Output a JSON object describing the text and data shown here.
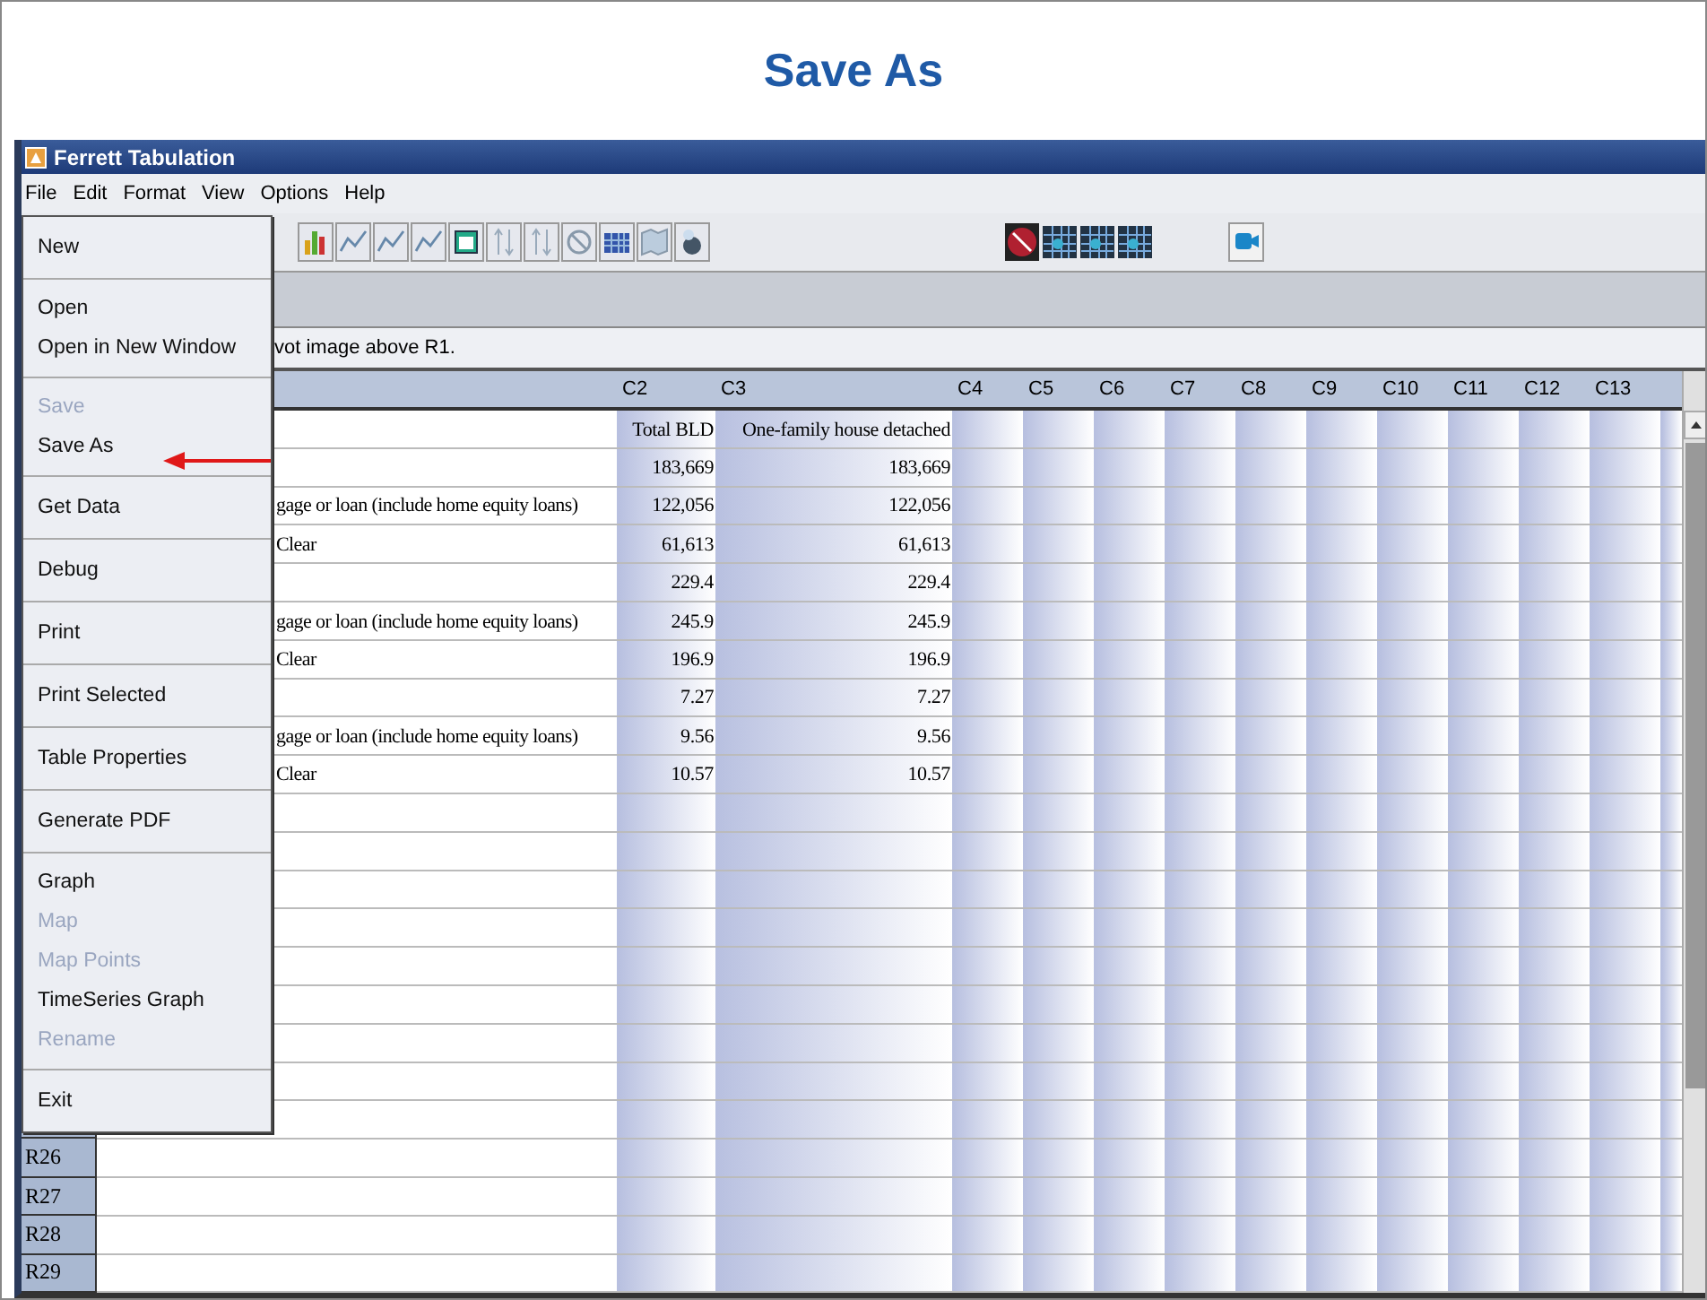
{
  "slide_title": "Save As",
  "window": {
    "title": "Ferrett Tabulation"
  },
  "menu_bar": [
    "File",
    "Edit",
    "Format",
    "View",
    "Options",
    "Help"
  ],
  "info_line": "vot image above R1.",
  "table": {
    "columns": [
      "C2",
      "C3",
      "C4",
      "C5",
      "C6",
      "C7",
      "C8",
      "C9",
      "C10",
      "C11",
      "C12",
      "C13"
    ],
    "rows": [
      {
        "label": "",
        "c2": "Total BLD",
        "c3": "One-family house detached"
      },
      {
        "label": "",
        "c2": "183,669",
        "c3": "183,669"
      },
      {
        "label": "gage or loan (include home equity loans)",
        "c2": "122,056",
        "c3": "122,056"
      },
      {
        "label": "Clear",
        "c2": "61,613",
        "c3": "61,613"
      },
      {
        "label": "",
        "c2": "229.4",
        "c3": "229.4"
      },
      {
        "label": "gage or loan (include home equity loans)",
        "c2": "245.9",
        "c3": "245.9"
      },
      {
        "label": "Clear",
        "c2": "196.9",
        "c3": "196.9"
      },
      {
        "label": "",
        "c2": "7.27",
        "c3": "7.27"
      },
      {
        "label": "gage or loan (include home equity loans)",
        "c2": "9.56",
        "c3": "9.56"
      },
      {
        "label": "Clear",
        "c2": "10.57",
        "c3": "10.57"
      }
    ],
    "row_headers": [
      "R26",
      "R27",
      "R28",
      "R29"
    ]
  },
  "file_menu": {
    "groups": [
      {
        "items": [
          {
            "label": "New",
            "disabled": false
          }
        ]
      },
      {
        "items": [
          {
            "label": "Open",
            "disabled": false
          },
          {
            "label": "Open in New Window",
            "disabled": false
          }
        ]
      },
      {
        "items": [
          {
            "label": "Save",
            "disabled": true
          },
          {
            "label": "Save As",
            "disabled": false
          }
        ]
      },
      {
        "items": [
          {
            "label": "Get Data",
            "disabled": false
          }
        ]
      },
      {
        "items": [
          {
            "label": "Debug",
            "disabled": false
          }
        ]
      },
      {
        "items": [
          {
            "label": "Print",
            "disabled": false
          }
        ]
      },
      {
        "items": [
          {
            "label": "Print Selected",
            "disabled": false
          }
        ]
      },
      {
        "items": [
          {
            "label": "Table Properties",
            "disabled": false
          }
        ]
      },
      {
        "items": [
          {
            "label": "Generate PDF",
            "disabled": false
          }
        ]
      },
      {
        "items": [
          {
            "label": "Graph",
            "disabled": false
          },
          {
            "label": "Map",
            "disabled": true
          },
          {
            "label": "Map Points",
            "disabled": true
          },
          {
            "label": "TimeSeries Graph",
            "disabled": false
          },
          {
            "label": "Rename",
            "disabled": true
          }
        ]
      },
      {
        "items": [
          {
            "label": "Exit",
            "disabled": false
          }
        ]
      }
    ]
  }
}
